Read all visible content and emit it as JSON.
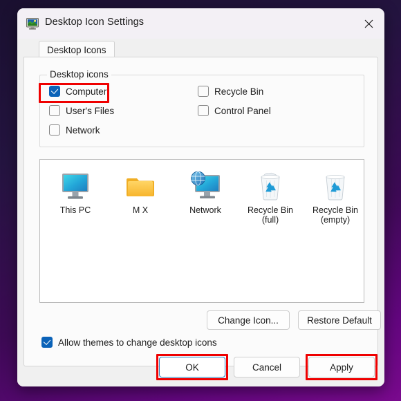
{
  "window": {
    "title": "Desktop Icon Settings",
    "title_icon": "display-monitor-icon",
    "close_icon": "close-icon"
  },
  "tabs": [
    {
      "label": "Desktop Icons",
      "selected": true
    }
  ],
  "groupbox": {
    "legend": "Desktop icons",
    "checkboxes": [
      {
        "label": "Computer",
        "checked": true,
        "column": "left",
        "highlighted": true
      },
      {
        "label": "User's Files",
        "checked": false,
        "column": "left",
        "highlighted": false
      },
      {
        "label": "Network",
        "checked": false,
        "column": "left",
        "highlighted": false
      },
      {
        "label": "Recycle Bin",
        "checked": false,
        "column": "right",
        "highlighted": false
      },
      {
        "label": "Control Panel",
        "checked": false,
        "column": "right",
        "highlighted": false
      }
    ]
  },
  "preview": {
    "icons": [
      {
        "caption": "This PC",
        "icon": "monitor-icon"
      },
      {
        "caption": "M X",
        "icon": "folder-icon"
      },
      {
        "caption": "Network",
        "icon": "network-monitor-globe-icon"
      },
      {
        "caption": "Recycle Bin\n(full)",
        "caption_line1": "Recycle Bin",
        "caption_line2": "(full)",
        "icon": "recycle-bin-full-icon"
      },
      {
        "caption": "Recycle Bin\n(empty)",
        "caption_line1": "Recycle Bin",
        "caption_line2": "(empty)",
        "icon": "recycle-bin-empty-icon"
      }
    ]
  },
  "actions": {
    "change_icon": "Change Icon...",
    "restore_default": "Restore Default"
  },
  "allow_themes": {
    "label": "Allow themes to change desktop icons",
    "checked": true
  },
  "footer": {
    "ok": "OK",
    "cancel": "Cancel",
    "apply": "Apply",
    "default_button": "OK"
  },
  "annotations": {
    "color": "#ef0000",
    "boxes": [
      "computer-checkbox",
      "ok-button",
      "apply-button"
    ]
  },
  "colors": {
    "accent": "#0a62b8",
    "default_button_border": "#2a7ec0",
    "annotation": "#ef0000",
    "dialog_bg": "#f0f0f0",
    "panel_bg": "#fbfbfb",
    "desktop_bg_top": "#1a1030",
    "desktop_bg_bottom": "#7a0a8e"
  }
}
